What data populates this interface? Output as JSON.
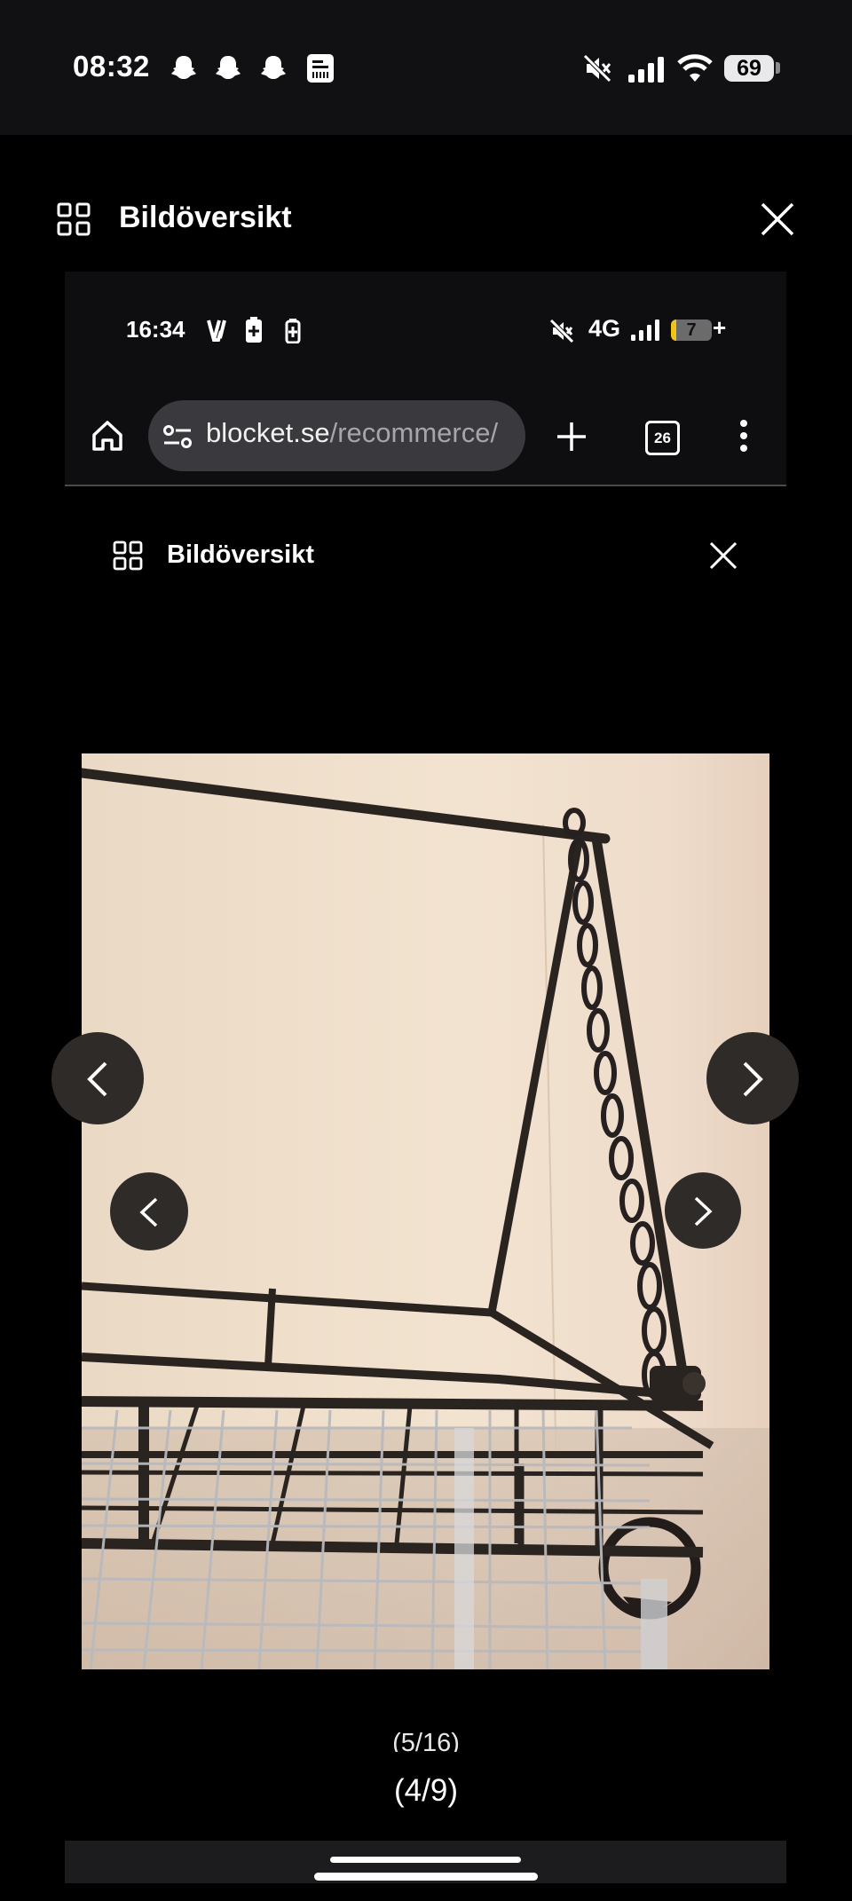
{
  "outer_status": {
    "time": "08:32",
    "battery": "69",
    "icons": [
      "snapchat-icon",
      "snapchat-icon",
      "snapchat-icon",
      "receipt-icon",
      "mute-icon",
      "signal-icon",
      "wifi-icon",
      "battery-icon"
    ]
  },
  "outer_header": {
    "title": "Bildöversikt",
    "icons": [
      "grid-icon",
      "close-icon"
    ]
  },
  "inner_status": {
    "time": "16:34",
    "network": "4G",
    "battery": "7",
    "charging": "+"
  },
  "browser": {
    "url_domain": "blocket.se",
    "url_path": "/recommerce/",
    "tab_count": "26",
    "icons": [
      "home-icon",
      "site-settings-icon",
      "new-tab-icon",
      "tabs-icon",
      "more-icon"
    ]
  },
  "inner_header": {
    "title": "Bildöversikt"
  },
  "gallery": {
    "outer_counter": "(5/16)",
    "inner_counter": "(4/9)",
    "icons": [
      "chevron-left-icon",
      "chevron-right-icon"
    ]
  },
  "colors": {
    "background": "#000000",
    "status_bar": "#111113",
    "url_pill": "#3a3a3e",
    "battery_low": "#f0c419"
  }
}
